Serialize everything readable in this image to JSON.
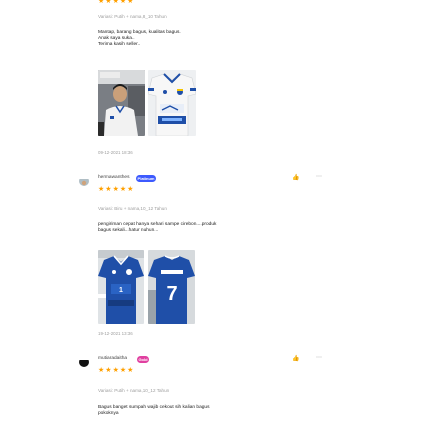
{
  "reviews": [
    {
      "stars": 5,
      "variant": "Variasi: Putih + nama,8_10 Tahun",
      "text_lines": [
        "Mantap, barang bagus, kualitas bagus.",
        "Anak saya suka..",
        "Terima kasih seller.."
      ],
      "date": "09-12-2021 18:36"
    },
    {
      "username": "hermawanthes",
      "badge": "Platinum",
      "stars": 5,
      "variant": "Variasi: Biru + nama,10_12 Tahun",
      "text_lines": [
        "pengiriman cepat hanya sehari sampe cirebon....produk",
        "bagus sekali...hatur nuhun..."
      ],
      "date": "19-12-2021 13:36"
    },
    {
      "username": "mutiaradaitha",
      "badge": "Gold",
      "stars": 5,
      "variant": "Variasi: Putih + nama,10_12 Tahun",
      "text_lines": [
        "Bagus banget sumpah wajib cekout sih kalian bagus",
        "pokoknya"
      ]
    }
  ],
  "colors": {
    "star": "#ffa000",
    "platinum": "#3d5afe",
    "gold": "#e040a0",
    "jersey_white": "#f4f4f4",
    "jersey_blue": "#1f4fa8"
  },
  "icons": {
    "star": "star-icon",
    "like": "thumb-up-icon",
    "more": "more-options-icon"
  }
}
